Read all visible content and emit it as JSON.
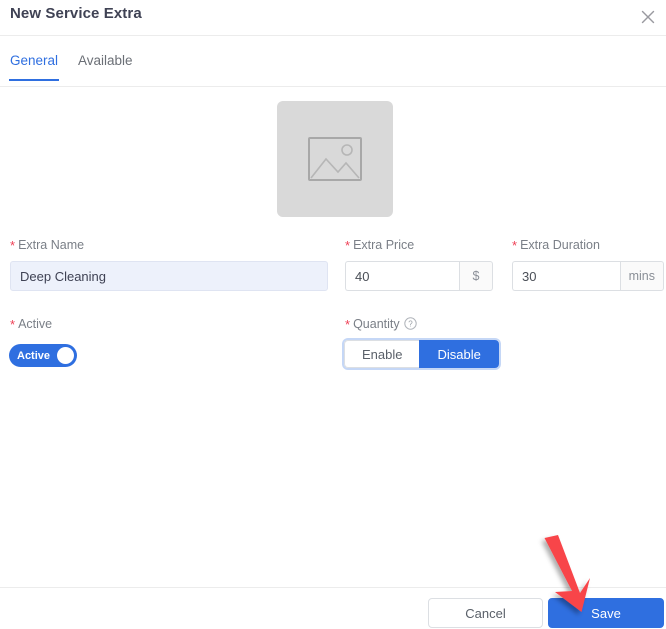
{
  "header": {
    "title": "New Service Extra",
    "close_icon": "close-icon"
  },
  "tabs": [
    {
      "label": "General",
      "active": true
    },
    {
      "label": "Available",
      "active": false
    }
  ],
  "image_upload": {
    "icon": "image-placeholder-icon",
    "value": ""
  },
  "fields": {
    "extra_name": {
      "label": "Extra Name",
      "required_marker": "*",
      "value": "Deep Cleaning",
      "placeholder": "Extra Name"
    },
    "extra_price": {
      "label": "Extra Price",
      "required_marker": "*",
      "value": "40",
      "suffix": "$",
      "placeholder": "Extra Price"
    },
    "extra_duration": {
      "label": "Extra Duration",
      "required_marker": "*",
      "value": "30",
      "suffix": "mins",
      "placeholder": "Extra Duration"
    },
    "active": {
      "label": "Active",
      "required_marker": "*",
      "state_label": "Active",
      "state_on": true
    },
    "quantity": {
      "label": "Quantity",
      "required_marker": "*",
      "help_icon": "question-mark-circle-icon",
      "options": [
        {
          "label": "Enable",
          "selected": false
        },
        {
          "label": "Disable",
          "selected": true
        }
      ]
    }
  },
  "footer": {
    "cancel_label": "Cancel",
    "save_label": "Save"
  },
  "annotation": {
    "type": "arrow",
    "points_at": "save-button",
    "color": "#f8444a"
  },
  "colors": {
    "accent": "#2f6fe0",
    "required": "#ef4056",
    "label_text": "#7a7f87",
    "title_text": "#3f4254",
    "border": "#dcdfe3",
    "autofill_bg": "#edf1fb",
    "placeholder_bg": "#d9d9d9",
    "annotation_red": "#f8444a"
  }
}
